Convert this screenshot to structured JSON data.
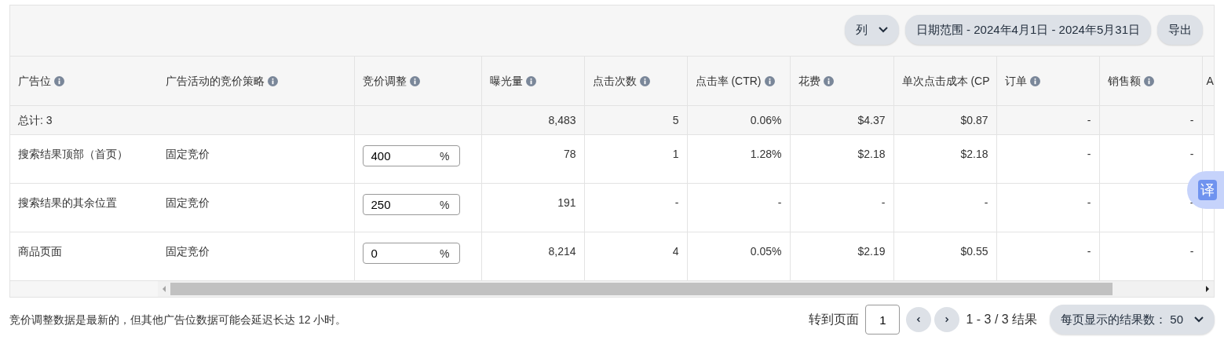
{
  "toolbar": {
    "buttons": [
      {
        "label": "列",
        "kind": "dropdown"
      },
      {
        "label": "日期范围 - 2024年4月1日 - 2024年5月31日",
        "kind": "plain"
      },
      {
        "label": "导出",
        "kind": "plain"
      }
    ]
  },
  "table": {
    "columns": [
      {
        "label": "广告位",
        "info": true
      },
      {
        "label": "广告活动的竞价策略",
        "info": true
      },
      {
        "label": "竞价调整",
        "info": true
      },
      {
        "label": "曝光量",
        "info": true
      },
      {
        "label": "点击次数",
        "info": true
      },
      {
        "label": "点击率 (CTR)",
        "info": true
      },
      {
        "label": "花费",
        "info": true
      },
      {
        "label": "单次点击成本 (CP",
        "info": false
      },
      {
        "label": "订单",
        "info": true
      },
      {
        "label": "销售额",
        "info": true
      },
      {
        "label": "A",
        "info": false
      }
    ],
    "total_row": {
      "label": "总计: 3",
      "values": [
        "8,483",
        "5",
        "0.06%",
        "$4.37",
        "$0.87",
        "-",
        "-"
      ]
    },
    "rows": [
      {
        "placement": "搜索结果顶部（首页）",
        "strategy": "固定竞价",
        "adjustment": "400",
        "unit": "%",
        "values": [
          "78",
          "1",
          "1.28%",
          "$2.18",
          "$2.18",
          "-",
          "-"
        ]
      },
      {
        "placement": "搜索结果的其余位置",
        "strategy": "固定竞价",
        "adjustment": "250",
        "unit": "%",
        "values": [
          "191",
          "-",
          "-",
          "-",
          "-",
          "-",
          "-"
        ]
      },
      {
        "placement": "商品页面",
        "strategy": "固定竞价",
        "adjustment": "0",
        "unit": "%",
        "values": [
          "8,214",
          "4",
          "0.05%",
          "$2.19",
          "$0.55",
          "-",
          "-"
        ]
      }
    ]
  },
  "translate_widget": {
    "label": "译"
  },
  "footer": {
    "note": "竞价调整数据是最新的，但其他广告位数据可能会延迟长达 12 小时。",
    "goto_label": "转到页面",
    "page": "1",
    "range": "1 - 3 / 3 结果",
    "page_size": "每页显示的结果数： 50"
  }
}
